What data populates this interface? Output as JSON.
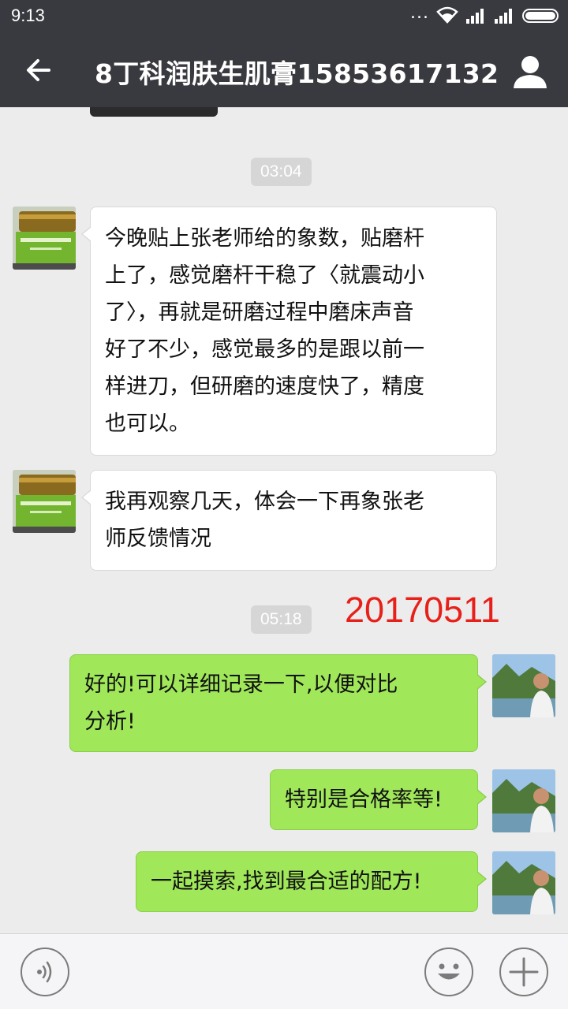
{
  "status_bar": {
    "time": "9:13",
    "dots": "..."
  },
  "header": {
    "title": "8丁科润肤生肌膏15853617132"
  },
  "chat": {
    "messages": [
      {
        "type": "timestamp",
        "text": "03:04"
      },
      {
        "type": "received",
        "sender": "contact",
        "lines": [
          "今晚贴上张老师给的象数，贴磨杆",
          "上了，感觉磨杆干稳了〈就震动小",
          "了〉，再就是研磨过程中磨床声音",
          "好了不少，感觉最多的是跟以前一",
          "样进刀，但研磨的速度快了，精度",
          "也可以。"
        ]
      },
      {
        "type": "received",
        "sender": "contact",
        "lines": [
          "我再观察几天，体会一下再象张老",
          "师反馈情况"
        ]
      },
      {
        "type": "timestamp",
        "text": "05:18"
      },
      {
        "type": "sent",
        "sender": "me",
        "lines": [
          "好的!可以详细记录一下,以便对比",
          "分析!"
        ]
      },
      {
        "type": "sent",
        "sender": "me",
        "lines": [
          "特别是合格率等!"
        ]
      },
      {
        "type": "sent",
        "sender": "me",
        "lines": [
          "一起摸索,找到最合适的配方!"
        ]
      }
    ],
    "annotation": "20170511"
  },
  "colors": {
    "bar": "#393a3f",
    "background": "#ececec",
    "sent_bubble": "#a0e75a",
    "received_bubble": "#ffffff",
    "annotation": "#e8201a"
  }
}
